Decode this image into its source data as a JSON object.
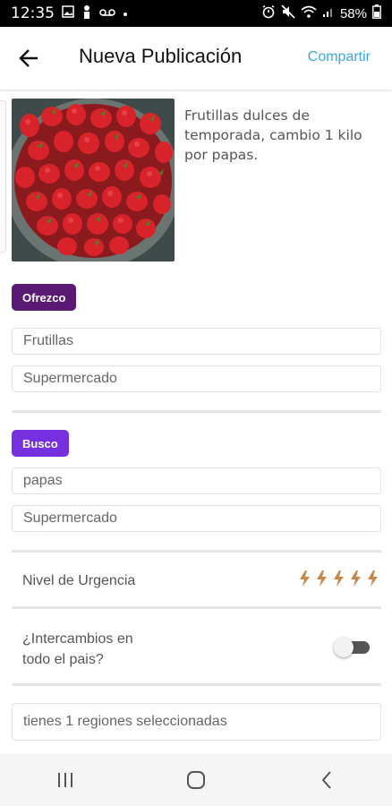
{
  "status_bar": {
    "time": "12:35",
    "battery": "58%"
  },
  "header": {
    "title": "Nueva Publicación",
    "share_label": "Compartir"
  },
  "post": {
    "description": "Frutillas dulces de temporada, cambio 1 kilo por papas."
  },
  "offer": {
    "tag": "Ofrezco",
    "item": "Frutillas",
    "category": "Supermercado"
  },
  "seek": {
    "tag": "Busco",
    "item": "papas",
    "category": "Supermercado"
  },
  "urgency": {
    "label": "Nivel de Urgencia",
    "level": 5,
    "max": 5
  },
  "nationwide": {
    "label_line1": "¿Intercambios en",
    "label_line2": "todo el pais?",
    "enabled": false
  },
  "regions": {
    "text": "tienes 1 regiones seleccionadas"
  },
  "colors": {
    "accent_link": "#3aa6dc",
    "offer_tag": "#5a1a73",
    "seek_tag": "#7630e0",
    "bolt": "#c8874a"
  }
}
